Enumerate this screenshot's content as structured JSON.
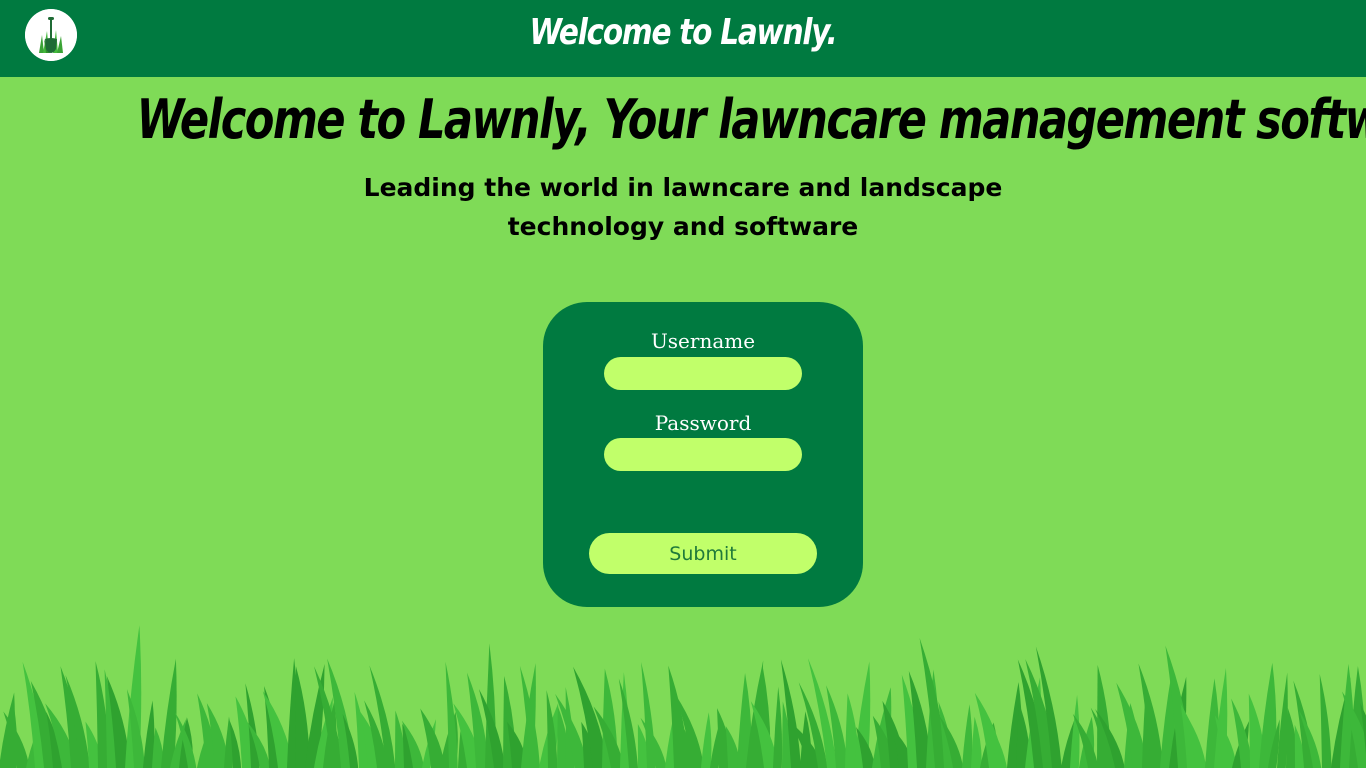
{
  "header": {
    "title": "Welcome to Lawnly.",
    "logo_icon": "shovel-grass-icon"
  },
  "hero": {
    "headline": "Welcome to Lawnly, Your lawncare management software.",
    "subline_1": "Leading the world in lawncare and landscape",
    "subline_2": "technology and software"
  },
  "login": {
    "username_label": "Username",
    "username_value": "",
    "password_label": "Password",
    "password_value": "",
    "submit_label": "Submit"
  },
  "colors": {
    "background": "#7fdb57",
    "header": "#007a40",
    "card": "#007a40",
    "input": "#c1ff6a",
    "grass": "#3db83a"
  }
}
